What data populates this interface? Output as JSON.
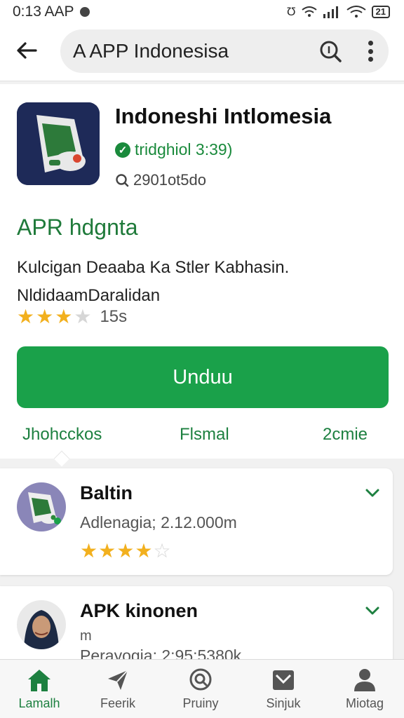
{
  "status_bar": {
    "time": "0:13 AAP",
    "right_text": "Ʊ",
    "battery": "21"
  },
  "top_bar": {
    "search_text": "A  APP Indonesisa",
    "icons": [
      "back-arrow-icon",
      "search-icon",
      "more-vert-icon"
    ]
  },
  "app": {
    "title": "Indoneshi  Intlomesia",
    "verified_text": "tridghiol 3:39)",
    "size_text": "2901ot5do",
    "subtitle": "APR hdgnta",
    "desc_line1": "Kulcigan Deaaba Ka Stler Kabhasin.",
    "desc_line2": "NldidaamDaralidan",
    "rating_stars": 3,
    "rating_count": "15s",
    "download_label": "Unduu"
  },
  "tabs": [
    "Jhohcckos",
    "Flsmal",
    "2cmie"
  ],
  "list": [
    {
      "title": "Baltin",
      "subtitle": "Adlenagia; 2.12.000m",
      "stars": 4
    },
    {
      "title": "APK kinonen",
      "subtitle": "m",
      "subtitle2": "Perayogia: 2:95:5380k"
    }
  ],
  "bottom_nav": [
    {
      "label": "Lamalh",
      "icon": "home-icon"
    },
    {
      "label": "Feerik",
      "icon": "send-icon"
    },
    {
      "label": "Pruiny",
      "icon": "search-icon"
    },
    {
      "label": "Sinjuk",
      "icon": "mail-icon"
    },
    {
      "label": "Miotag",
      "icon": "person-icon"
    }
  ],
  "colors": {
    "accent_green": "#1aa14a",
    "text_green": "#1d8040",
    "star_gold": "#f2b01e",
    "app_icon_bg": "#1e2a58"
  }
}
